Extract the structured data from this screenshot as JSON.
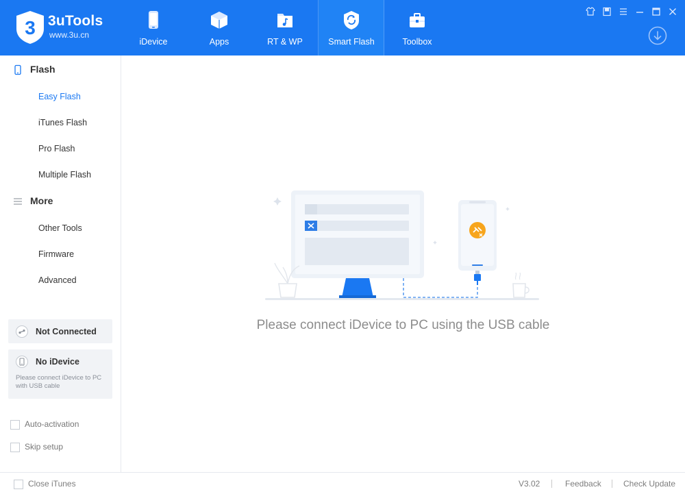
{
  "app": {
    "name": "3uTools",
    "url": "www.3u.cn",
    "logo_glyph": "3",
    "brand_color": "#1a78f2"
  },
  "nav": {
    "items": [
      {
        "label": "iDevice",
        "icon": "phone-icon"
      },
      {
        "label": "Apps",
        "icon": "cube-icon"
      },
      {
        "label": "RT & WP",
        "icon": "music-folder-icon"
      },
      {
        "label": "Smart Flash",
        "icon": "refresh-shield-icon",
        "active": true
      },
      {
        "label": "Toolbox",
        "icon": "briefcase-icon"
      }
    ]
  },
  "window_controls": [
    "skin-icon",
    "feedback-icon",
    "menu-icon",
    "minimize-icon",
    "maximize-icon",
    "close-icon"
  ],
  "sidebar": {
    "flash": {
      "title": "Flash",
      "items": [
        "Easy Flash",
        "iTunes Flash",
        "Pro Flash",
        "Multiple Flash"
      ],
      "active": "Easy Flash"
    },
    "more": {
      "title": "More",
      "items": [
        "Other Tools",
        "Firmware",
        "Advanced"
      ]
    },
    "connection": {
      "status": "Not Connected"
    },
    "device": {
      "title": "No iDevice",
      "description": "Please connect iDevice to PC with USB cable"
    },
    "options": [
      {
        "label": "Auto-activation",
        "checked": false
      },
      {
        "label": "Skip setup",
        "checked": false
      }
    ]
  },
  "main": {
    "message": "Please connect iDevice to PC using the USB cable"
  },
  "footer": {
    "close_itunes": "Close iTunes",
    "version": "V3.02",
    "feedback": "Feedback",
    "check_update": "Check Update"
  },
  "colors": {
    "header": "#1a78f2",
    "active_nav": "#2083f5",
    "active_item": "#1a78f2",
    "card_bg": "#f1f3f6",
    "link_badge": "#f7a51c"
  }
}
